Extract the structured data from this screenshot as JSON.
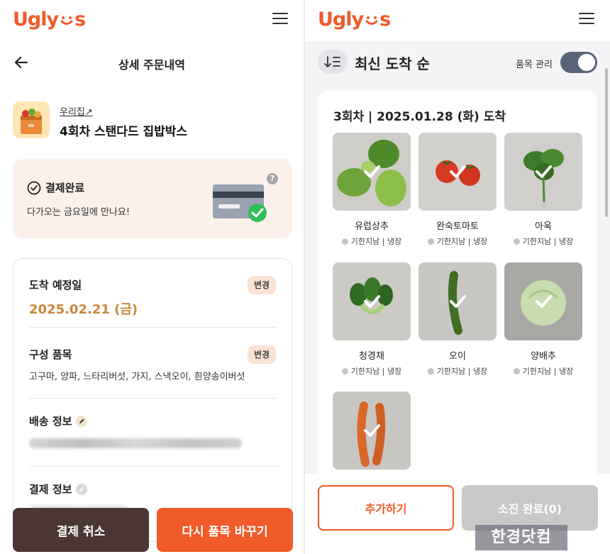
{
  "app": {
    "brand": "Ugly Us",
    "accent_color": "#f15a29"
  },
  "left": {
    "page_title": "상세 주문내역",
    "product": {
      "store_link": "우리집↗",
      "name": "4회차 스탠다드 집밥박스"
    },
    "payment_card": {
      "status": "결제완료",
      "message": "다가오는 금요일에 만나요!",
      "help": "?"
    },
    "details": {
      "arrival_label": "도착 예정일",
      "arrival_date": "2025.02.21 (금)",
      "items_label": "구성 품목",
      "items_value": "고구마, 양파, 느타리버섯, 가지, 스낵오이, 흰양송이버섯",
      "change_label": "변경",
      "shipping_label": "배송 정보",
      "payment_label": "결제 정보"
    },
    "buttons": {
      "cancel": "결제 취소",
      "swap": "다시 품목 바꾸기"
    }
  },
  "right": {
    "sort_label": "최신 도착 순",
    "manage_label": "품목 관리",
    "toggle_on": true,
    "section_title": "3회차 | 2025.01.28 (화) 도착",
    "items": [
      {
        "name": "유럽상추",
        "meta": "기한지남 | 냉장"
      },
      {
        "name": "완숙토마토",
        "meta": "기한지남 | 냉장"
      },
      {
        "name": "아욱",
        "meta": "기한지남 | 냉장"
      },
      {
        "name": "청경채",
        "meta": "기한지남 | 냉장"
      },
      {
        "name": "오이",
        "meta": "기한지남 | 냉장"
      },
      {
        "name": "양배추",
        "meta": "기한지남 | 냉장"
      },
      {
        "name": "당근",
        "meta": ""
      }
    ],
    "buttons": {
      "add": "추가하기",
      "done": "소진 완료(0)"
    }
  },
  "watermark": "한경닷컴"
}
